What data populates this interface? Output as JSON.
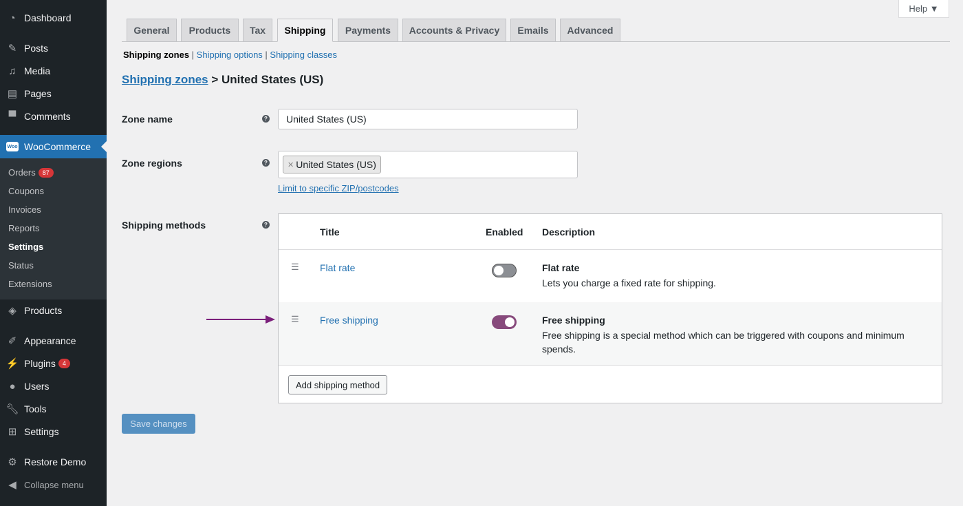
{
  "sidebar": {
    "items": [
      {
        "label": "Dashboard",
        "icon": "dashboard-icon"
      },
      {
        "label": "Posts",
        "icon": "pin-icon"
      },
      {
        "label": "Media",
        "icon": "media-icon"
      },
      {
        "label": "Pages",
        "icon": "pages-icon"
      },
      {
        "label": "Comments",
        "icon": "comment-icon"
      },
      {
        "label": "WooCommerce",
        "icon": "woo-icon",
        "logo": "Woo"
      },
      {
        "label": "Products",
        "icon": "box-icon"
      },
      {
        "label": "Appearance",
        "icon": "brush-icon"
      },
      {
        "label": "Plugins",
        "icon": "plug-icon",
        "badge": "4"
      },
      {
        "label": "Users",
        "icon": "user-icon"
      },
      {
        "label": "Tools",
        "icon": "wrench-icon"
      },
      {
        "label": "Settings",
        "icon": "settings-icon"
      },
      {
        "label": "Restore Demo",
        "icon": "gear-icon"
      },
      {
        "label": "Collapse menu",
        "icon": "collapse-icon"
      }
    ],
    "submenu": [
      {
        "label": "Orders",
        "badge": "87"
      },
      {
        "label": "Coupons"
      },
      {
        "label": "Invoices"
      },
      {
        "label": "Reports"
      },
      {
        "label": "Settings"
      },
      {
        "label": "Status"
      },
      {
        "label": "Extensions"
      }
    ]
  },
  "help": "Help ▼",
  "tabs": [
    "General",
    "Products",
    "Tax",
    "Shipping",
    "Payments",
    "Accounts & Privacy",
    "Emails",
    "Advanced"
  ],
  "subsub": {
    "current": "Shipping zones",
    "links": [
      "Shipping options",
      "Shipping classes"
    ],
    "sep": " | "
  },
  "heading": {
    "link": "Shipping zones",
    "rest": " > United States (US)"
  },
  "form": {
    "zone_name_label": "Zone name",
    "zone_name_value": "United States (US)",
    "zone_regions_label": "Zone regions",
    "region_chip": "United States (US)",
    "limit_link": "Limit to specific ZIP/postcodes",
    "methods_label": "Shipping methods",
    "help_glyph": "?"
  },
  "methods": {
    "headers": {
      "title": "Title",
      "enabled": "Enabled",
      "description": "Description"
    },
    "rows": [
      {
        "title": "Flat rate",
        "enabled": false,
        "desc_title": "Flat rate",
        "desc": "Lets you charge a fixed rate for shipping."
      },
      {
        "title": "Free shipping",
        "enabled": true,
        "desc_title": "Free shipping",
        "desc": "Free shipping is a special method which can be triggered with coupons and minimum spends."
      }
    ],
    "add_button": "Add shipping method"
  },
  "save_button": "Save changes",
  "colors": {
    "accent": "#2271b1",
    "toggle_on": "#874a7c",
    "arrow": "#7b1f7b"
  }
}
